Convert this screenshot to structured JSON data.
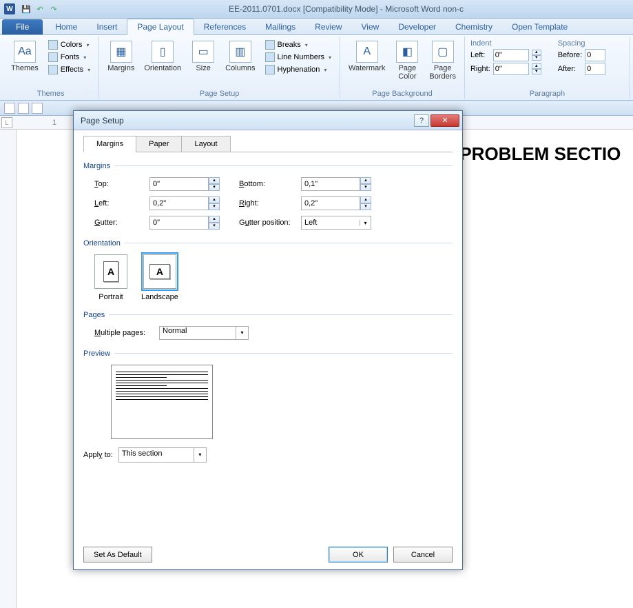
{
  "title": "EE-2011.0701.docx [Compatibility Mode] - Microsoft Word non-c",
  "ribbon_tabs": [
    "Home",
    "Insert",
    "Page Layout",
    "References",
    "Mailings",
    "Review",
    "View",
    "Developer",
    "Chemistry",
    "Open Template"
  ],
  "file_tab": "File",
  "active_tab": "Page Layout",
  "themes_group": {
    "label": "Themes",
    "themes": "Themes",
    "colors": "Colors",
    "fonts": "Fonts",
    "effects": "Effects"
  },
  "pagesetup_group": {
    "label": "Page Setup",
    "margins": "Margins",
    "orientation": "Orientation",
    "size": "Size",
    "columns": "Columns",
    "breaks": "Breaks",
    "linenum": "Line Numbers",
    "hyph": "Hyphenation"
  },
  "bg_group": {
    "label": "Page Background",
    "watermark": "Watermark",
    "pagecolor": "Page\nColor",
    "borders": "Page\nBorders"
  },
  "para_group": {
    "label": "Paragraph",
    "indent": "Indent",
    "spacing": "Spacing",
    "left": "Left:",
    "right": "Right:",
    "before": "Before:",
    "after": "After:",
    "lval": "0\"",
    "rval": "0\"",
    "bval": "0",
    "aval": "0"
  },
  "doc_heading": "HE PROBLEM SECTIO",
  "dialog": {
    "title": "Page Setup",
    "tabs": [
      "Margins",
      "Paper",
      "Layout"
    ],
    "active_tab": "Margins",
    "sections": {
      "margins": "Margins",
      "orientation": "Orientation",
      "pages": "Pages",
      "preview": "Preview"
    },
    "labels": {
      "top": "Top:",
      "bottom": "Bottom:",
      "left": "Left:",
      "right": "Right:",
      "gutter": "Gutter:",
      "gutterpos": "Gutter position:",
      "portrait": "Portrait",
      "landscape": "Landscape",
      "multi": "Multiple pages:",
      "applyto": "Apply to:"
    },
    "values": {
      "top": "0\"",
      "bottom": "0,1\"",
      "left": "0,2\"",
      "right": "0,2\"",
      "gutter": "0\"",
      "gutterpos": "Left",
      "multi": "Normal",
      "applyto": "This section"
    },
    "buttons": {
      "default": "Set As Default",
      "ok": "OK",
      "cancel": "Cancel"
    }
  }
}
